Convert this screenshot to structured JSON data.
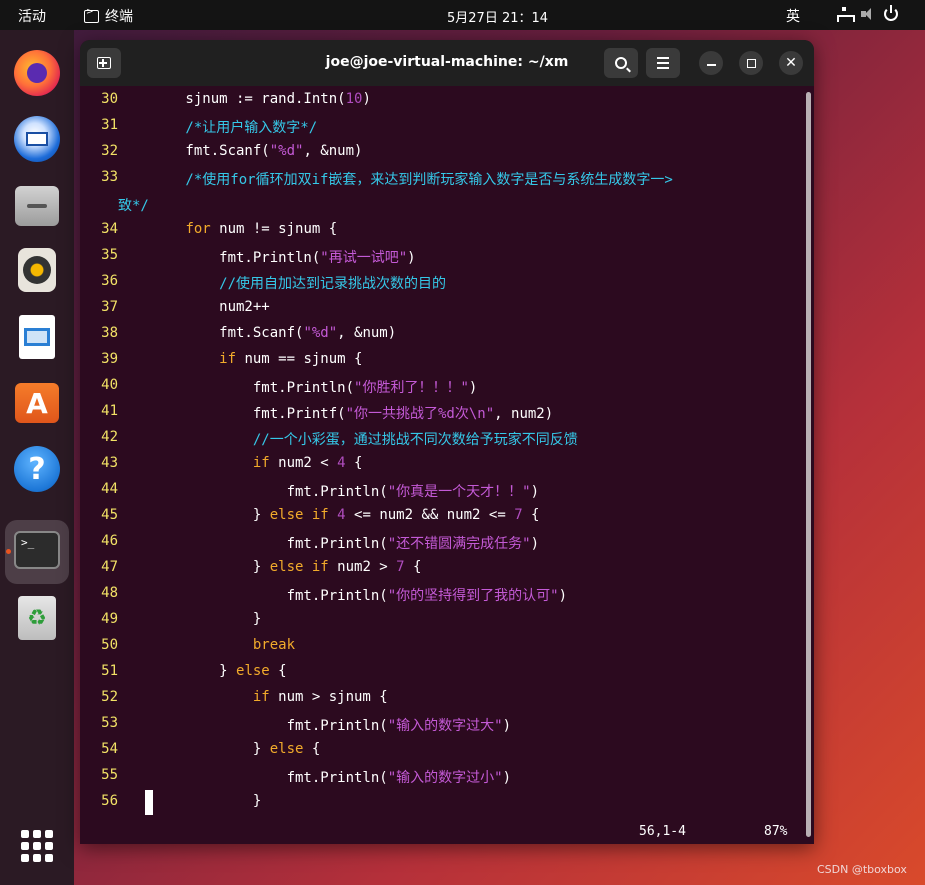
{
  "topbar": {
    "activities": "活动",
    "app_name": "终端",
    "clock": "5月27日  21：14",
    "ime": "英",
    "tray_icons": [
      "network-icon",
      "volume-icon",
      "power-icon"
    ]
  },
  "dock": {
    "items": [
      "firefox",
      "thunderbird",
      "files",
      "rhythmbox",
      "libreoffice-writer",
      "app-center",
      "help",
      "terminal",
      "trash"
    ],
    "active": "terminal",
    "grid_label": "show-applications"
  },
  "window": {
    "title": "joe@joe-virtual-machine: ~/xm",
    "status_position": "56,1-4",
    "status_percent": "87%"
  },
  "code": {
    "lines": [
      {
        "n": "30",
        "segs": [
          {
            "t": "        sjnum := rand.Intn(",
            "c": ""
          },
          {
            "t": "10",
            "c": "num"
          },
          {
            "t": ")",
            "c": ""
          }
        ]
      },
      {
        "n": "31",
        "segs": [
          {
            "t": "        /*让用户输入数字*/",
            "c": "cm"
          }
        ]
      },
      {
        "n": "32",
        "segs": [
          {
            "t": "        fmt.Scanf(",
            "c": ""
          },
          {
            "t": "\"%d\"",
            "c": "str"
          },
          {
            "t": ", &num)",
            "c": ""
          }
        ]
      },
      {
        "n": "33",
        "segs": [
          {
            "t": "        /*使用for循环加双if嵌套，来达到判断玩家输入数字是否与系统生成数字一>",
            "c": "cm"
          }
        ]
      },
      {
        "n": "",
        "segs": [
          {
            "t": "致*/",
            "c": "cm"
          }
        ]
      },
      {
        "n": "34",
        "segs": [
          {
            "t": "        ",
            "c": ""
          },
          {
            "t": "for",
            "c": "kw"
          },
          {
            "t": " num != sjnum {",
            "c": ""
          }
        ]
      },
      {
        "n": "35",
        "segs": [
          {
            "t": "            fmt.Println(",
            "c": ""
          },
          {
            "t": "\"再试一试吧\"",
            "c": "str"
          },
          {
            "t": ")",
            "c": ""
          }
        ]
      },
      {
        "n": "36",
        "segs": [
          {
            "t": "            //使用自加达到记录挑战次数的目的",
            "c": "cm"
          }
        ]
      },
      {
        "n": "37",
        "segs": [
          {
            "t": "            num2++",
            "c": ""
          }
        ]
      },
      {
        "n": "38",
        "segs": [
          {
            "t": "            fmt.Scanf(",
            "c": ""
          },
          {
            "t": "\"%d\"",
            "c": "str"
          },
          {
            "t": ", &num)",
            "c": ""
          }
        ]
      },
      {
        "n": "39",
        "segs": [
          {
            "t": "            ",
            "c": ""
          },
          {
            "t": "if",
            "c": "kw"
          },
          {
            "t": " num == sjnum {",
            "c": ""
          }
        ]
      },
      {
        "n": "40",
        "segs": [
          {
            "t": "                fmt.Println(",
            "c": ""
          },
          {
            "t": "\"你胜利了！！！\"",
            "c": "str"
          },
          {
            "t": ")",
            "c": ""
          }
        ]
      },
      {
        "n": "41",
        "segs": [
          {
            "t": "                fmt.Printf(",
            "c": ""
          },
          {
            "t": "\"你一共挑战了%d次\\n\"",
            "c": "str"
          },
          {
            "t": ", num2)",
            "c": ""
          }
        ]
      },
      {
        "n": "42",
        "segs": [
          {
            "t": "                //一个小彩蛋，通过挑战不同次数给予玩家不同反馈",
            "c": "cm"
          }
        ]
      },
      {
        "n": "43",
        "segs": [
          {
            "t": "                ",
            "c": ""
          },
          {
            "t": "if",
            "c": "kw"
          },
          {
            "t": " num2 < ",
            "c": ""
          },
          {
            "t": "4",
            "c": "num"
          },
          {
            "t": " {",
            "c": ""
          }
        ]
      },
      {
        "n": "44",
        "segs": [
          {
            "t": "                    fmt.Println(",
            "c": ""
          },
          {
            "t": "\"你真是一个天才！！\"",
            "c": "str"
          },
          {
            "t": ")",
            "c": ""
          }
        ]
      },
      {
        "n": "45",
        "segs": [
          {
            "t": "                } ",
            "c": ""
          },
          {
            "t": "else if",
            "c": "kw"
          },
          {
            "t": " ",
            "c": ""
          },
          {
            "t": "4",
            "c": "num"
          },
          {
            "t": " <= num2 && num2 <= ",
            "c": ""
          },
          {
            "t": "7",
            "c": "num"
          },
          {
            "t": " {",
            "c": ""
          }
        ]
      },
      {
        "n": "46",
        "segs": [
          {
            "t": "                    fmt.Println(",
            "c": ""
          },
          {
            "t": "\"还不错圆满完成任务\"",
            "c": "str"
          },
          {
            "t": ")",
            "c": ""
          }
        ]
      },
      {
        "n": "47",
        "segs": [
          {
            "t": "                } ",
            "c": ""
          },
          {
            "t": "else if",
            "c": "kw"
          },
          {
            "t": " num2 > ",
            "c": ""
          },
          {
            "t": "7",
            "c": "num"
          },
          {
            "t": " {",
            "c": ""
          }
        ]
      },
      {
        "n": "48",
        "segs": [
          {
            "t": "                    fmt.Println(",
            "c": ""
          },
          {
            "t": "\"你的坚持得到了我的认可\"",
            "c": "str"
          },
          {
            "t": ")",
            "c": ""
          }
        ]
      },
      {
        "n": "49",
        "segs": [
          {
            "t": "                }",
            "c": ""
          }
        ]
      },
      {
        "n": "50",
        "segs": [
          {
            "t": "                ",
            "c": ""
          },
          {
            "t": "break",
            "c": "kw"
          }
        ]
      },
      {
        "n": "51",
        "segs": [
          {
            "t": "            } ",
            "c": ""
          },
          {
            "t": "else",
            "c": "kw"
          },
          {
            "t": " {",
            "c": ""
          }
        ]
      },
      {
        "n": "52",
        "segs": [
          {
            "t": "                ",
            "c": ""
          },
          {
            "t": "if",
            "c": "kw"
          },
          {
            "t": " num > sjnum {",
            "c": ""
          }
        ]
      },
      {
        "n": "53",
        "segs": [
          {
            "t": "                    fmt.Println(",
            "c": ""
          },
          {
            "t": "\"输入的数字过大\"",
            "c": "str"
          },
          {
            "t": ")",
            "c": ""
          }
        ]
      },
      {
        "n": "54",
        "segs": [
          {
            "t": "                } ",
            "c": ""
          },
          {
            "t": "else",
            "c": "kw"
          },
          {
            "t": " {",
            "c": ""
          }
        ]
      },
      {
        "n": "55",
        "segs": [
          {
            "t": "                    fmt.Println(",
            "c": ""
          },
          {
            "t": "\"输入的数字过小\"",
            "c": "str"
          },
          {
            "t": ")",
            "c": ""
          }
        ]
      },
      {
        "n": "56",
        "segs": [
          {
            "t": "                }",
            "c": ""
          }
        ]
      }
    ]
  },
  "watermark": "CSDN @tboxbox",
  "colors": {
    "terminal_bg": "#2c0a1f",
    "line_number": "#f2e266",
    "keyword": "#f2ab2b",
    "string": "#c45ad6",
    "comment": "#35c8e8",
    "accent": "#e95420"
  }
}
